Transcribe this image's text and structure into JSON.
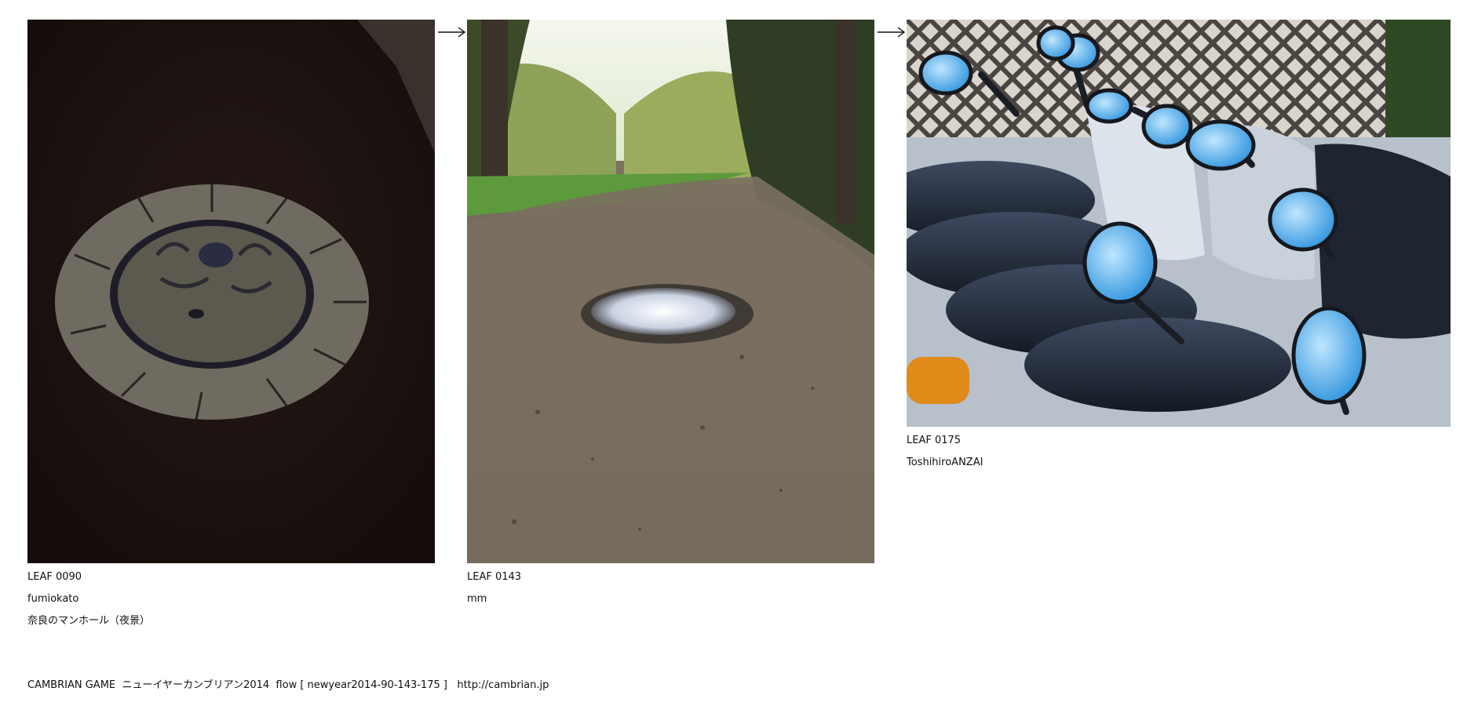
{
  "leaves": [
    {
      "id_label": "LEAF 0090",
      "author": "fumiokato",
      "title": "奈良のマンホール（夜景）",
      "image": "manhole-night-photo"
    },
    {
      "id_label": "LEAF 0143",
      "author": "mm",
      "image": "puddle-path-photo"
    },
    {
      "id_label": "LEAF 0175",
      "author": "ToshihiroANZAI",
      "image": "scooter-mirrors-photo"
    }
  ],
  "arrows": [
    "arrow-right-icon",
    "arrow-right-icon"
  ],
  "footer": {
    "text": "CAMBRIAN GAME  ニューイヤーカンブリアン2014  flow [ newyear2014-90-143-175 ]   ",
    "link": "http://cambrian.jp"
  }
}
